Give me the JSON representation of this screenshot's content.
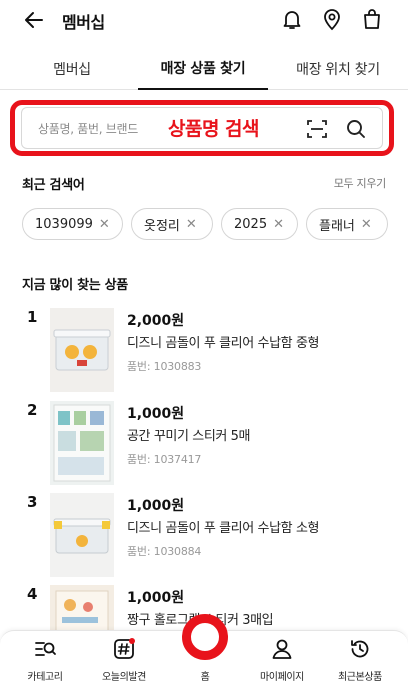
{
  "header": {
    "title": "멤버십"
  },
  "tabs": [
    {
      "label": "멤버십"
    },
    {
      "label": "매장 상품 찾기"
    },
    {
      "label": "매장 위치 찾기"
    }
  ],
  "search": {
    "placeholder": "상품명, 품번, 브랜드",
    "annotation": "상품명 검색"
  },
  "recent": {
    "title": "최근 검색어",
    "clear_label": "모두 지우기",
    "chips": [
      "1039099",
      "옷정리",
      "2025",
      "플래너"
    ]
  },
  "popular": {
    "title": "지금 많이 찾는 상품",
    "items": [
      {
        "rank": "1",
        "price": "2,000원",
        "name": "디즈니 곰돌이 푸 클리어 수납함 중형",
        "code": "품번: 1030883"
      },
      {
        "rank": "2",
        "price": "1,000원",
        "name": "공간 꾸미기 스티커 5매",
        "code": "품번: 1037417"
      },
      {
        "rank": "3",
        "price": "1,000원",
        "name": "디즈니 곰돌이 푸 클리어 수납함 소형",
        "code": "품번: 1030884"
      },
      {
        "rank": "4",
        "price": "1,000원",
        "name": "짱구 홀로그램 스티커 3매입",
        "code": ""
      }
    ]
  },
  "bottom_nav": {
    "category": "카테고리",
    "today": "오늘의발견",
    "home": "홈",
    "mypage": "마이페이지",
    "recent_viewed": "최근본상품"
  },
  "colors": {
    "accent": "#e8131b"
  }
}
